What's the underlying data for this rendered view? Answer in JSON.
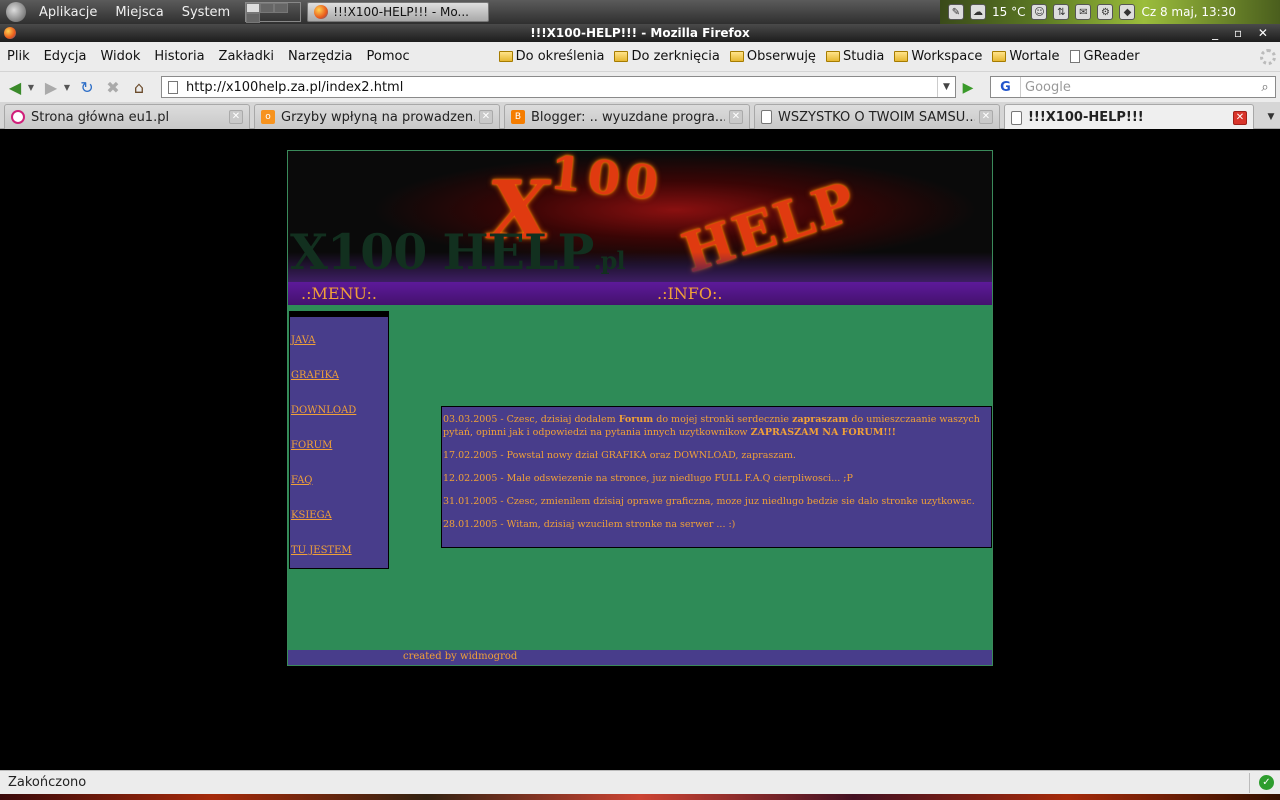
{
  "panel": {
    "menus": [
      "Aplikacje",
      "Miejsca",
      "System"
    ],
    "task_title": "!!!X100-HELP!!! - Mo...",
    "temperature": "15 °C",
    "clock": "Cz  8 maj, 13:30"
  },
  "window": {
    "title": "!!!X100-HELP!!! - Mozilla Firefox"
  },
  "menubar": {
    "items": [
      "Plik",
      "Edycja",
      "Widok",
      "Historia",
      "Zakładki",
      "Narzędzia",
      "Pomoc"
    ]
  },
  "bookmarks": [
    "Do określenia",
    "Do zerknięcia",
    "Obserwuję",
    "Studia",
    "Workspace",
    "Wortale",
    "GReader"
  ],
  "navbar": {
    "url": "http://x100help.za.pl/index2.html",
    "search_placeholder": "Google",
    "search_engine": "G"
  },
  "tabs": [
    {
      "title": "Strona główna eu1.pl",
      "icon": "eu1-icon"
    },
    {
      "title": "Grzyby wpłyną na prowadzen...",
      "icon": "onet-icon"
    },
    {
      "title": "Blogger: .. wyuzdane progra...",
      "icon": "blogger-icon"
    },
    {
      "title": "WSZYSTKO O TWOIM SAMSU...",
      "icon": "page-icon"
    },
    {
      "title": "!!!X100-HELP!!!",
      "icon": "page-icon",
      "active": true
    }
  ],
  "site": {
    "banner_title": "X100 HELP",
    "banner_title_suffix": ".pl",
    "banner_x": "X",
    "banner_100": "100",
    "banner_help": "HELP",
    "menu_label": ".:MENU:.",
    "info_label": ".:INFO:.",
    "menu_links": [
      "JAVA",
      "GRAFIKA",
      "DOWNLOAD",
      "FORUM",
      "FAQ",
      "KSIEGA",
      "TU JESTEM"
    ],
    "news": [
      {
        "pre": "03.03.2005 - Czesc, dzisiaj dodalem ",
        "b1": "Forum",
        "mid": " do mojej stronki serdecznie ",
        "b2": "zapraszam",
        "post": " do umieszczaanie waszych pytań, opinni jak i odpowiedzi na pytania innych uzytkownikow  ",
        "b3": "ZAPRASZAM NA FORUM!!!"
      },
      {
        "text": "17.02.2005 - Powstal nowy dział GRAFIKA oraz DOWNLOAD, zapraszam."
      },
      {
        "text": "12.02.2005 - Male odswiezenie na stronce, juz niedlugo FULL F.A.Q cierpliwosci... ;P"
      },
      {
        "text": "31.01.2005 - Czesc, zmienilem dzisiaj oprawe graficzna, moze juz niedlugo bedzie sie dalo stronke uzytkowac."
      },
      {
        "text": "28.01.2005 - Witam, dzisiaj wzucilem stronke na serwer ... :)"
      }
    ],
    "footer": "created by widmogrod"
  },
  "status": {
    "text": "Zakończono"
  },
  "colors": {
    "site_bg": "#2e8b57",
    "box_bg": "#483d8b",
    "link_text": "#f0a038",
    "strip": "#5d1a9a"
  }
}
